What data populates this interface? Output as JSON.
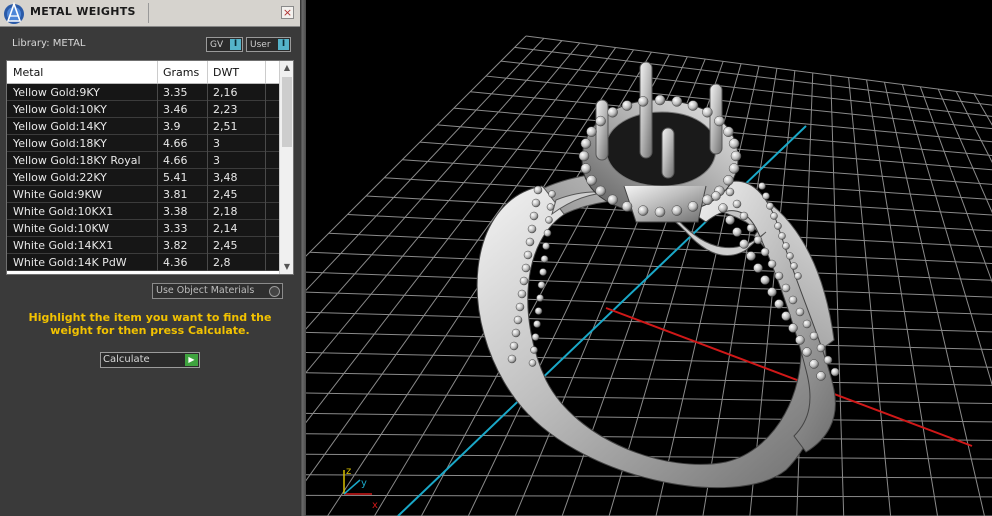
{
  "panel": {
    "title": "METAL WEIGHTS",
    "close_label": "×",
    "library_label": "Library: METAL",
    "gv_label": "GV",
    "user_label": "User",
    "toggle_symbol": "I",
    "table": {
      "headers": [
        "Metal",
        "Grams",
        "DWT"
      ],
      "rows": [
        {
          "metal": "Yellow Gold:9KY",
          "grams": "3.35",
          "dwt": "2,16"
        },
        {
          "metal": "Yellow Gold:10KY",
          "grams": "3.46",
          "dwt": "2,23"
        },
        {
          "metal": "Yellow Gold:14KY",
          "grams": "3.9",
          "dwt": "2,51"
        },
        {
          "metal": "Yellow Gold:18KY",
          "grams": "4.66",
          "dwt": "3"
        },
        {
          "metal": "Yellow Gold:18KY Royal",
          "grams": "4.66",
          "dwt": "3"
        },
        {
          "metal": "Yellow Gold:22KY",
          "grams": "5.41",
          "dwt": "3,48"
        },
        {
          "metal": "White Gold:9KW",
          "grams": "3.81",
          "dwt": "2,45"
        },
        {
          "metal": "White Gold:10KX1",
          "grams": "3.38",
          "dwt": "2,18"
        },
        {
          "metal": "White Gold:10KW",
          "grams": "3.33",
          "dwt": "2,14"
        },
        {
          "metal": "White Gold:14KX1",
          "grams": "3.82",
          "dwt": "2,45"
        },
        {
          "metal": "White Gold:14K PdW",
          "grams": "4.36",
          "dwt": "2,8"
        }
      ]
    },
    "use_object_materials": "Use Object Materials",
    "hint": "Highlight the item you want to find the weight for then press Calculate.",
    "calculate_label": "Calculate"
  },
  "viewport": {
    "axis_z": "z",
    "axis_y": "y",
    "axis_x": "x",
    "colors": {
      "grid": "#8a8a8a",
      "x_axis": "#d01818",
      "y_axis": "#1aa8c8",
      "hint": "#f2c200"
    }
  }
}
